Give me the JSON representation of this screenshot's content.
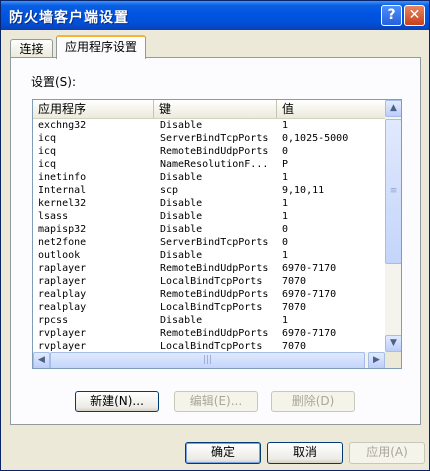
{
  "window": {
    "title": "防火墙客户端设置"
  },
  "tabs": [
    {
      "label": "连接"
    },
    {
      "label": "应用程序设置"
    }
  ],
  "settings_label": "设置(S):",
  "columns": [
    "应用程序",
    "键",
    "值"
  ],
  "rows": [
    [
      "exchng32",
      "Disable",
      "1"
    ],
    [
      "icq",
      "ServerBindTcpPorts",
      "0,1025-5000"
    ],
    [
      "icq",
      "RemoteBindUdpPorts",
      "0"
    ],
    [
      "icq",
      "NameResolutionF...",
      "P"
    ],
    [
      "inetinfo",
      "Disable",
      "1"
    ],
    [
      "Internal",
      "scp",
      "9,10,11"
    ],
    [
      "kernel32",
      "Disable",
      "1"
    ],
    [
      "lsass",
      "Disable",
      "1"
    ],
    [
      "mapisp32",
      "Disable",
      "0"
    ],
    [
      "net2fone",
      "ServerBindTcpPorts",
      "0"
    ],
    [
      "outlook",
      "Disable",
      "1"
    ],
    [
      "raplayer",
      "RemoteBindUdpPorts",
      "6970-7170"
    ],
    [
      "raplayer",
      "LocalBindTcpPorts",
      "7070"
    ],
    [
      "realplay",
      "RemoteBindUdpPorts",
      "6970-7170"
    ],
    [
      "realplay",
      "LocalBindTcpPorts",
      "7070"
    ],
    [
      "rpcss",
      "Disable",
      "1"
    ],
    [
      "rvplayer",
      "RemoteBindUdpPorts",
      "6970-7170"
    ],
    [
      "rvplayer",
      "LocalBindTcpPorts",
      "7070"
    ]
  ],
  "buttons": {
    "new": "新建(N)...",
    "edit": "编辑(E)...",
    "delete": "删除(D)",
    "ok": "确定",
    "cancel": "取消",
    "apply": "应用(A)"
  },
  "icons": {
    "help": "question-mark",
    "close": "x-mark",
    "scroll_up": "triangle-up",
    "scroll_down": "triangle-down",
    "scroll_left": "triangle-left",
    "scroll_right": "triangle-right"
  },
  "colors": {
    "titlebar": "#0054e3",
    "active_tab_accent": "#f8b431",
    "close_button": "#c8401a"
  }
}
